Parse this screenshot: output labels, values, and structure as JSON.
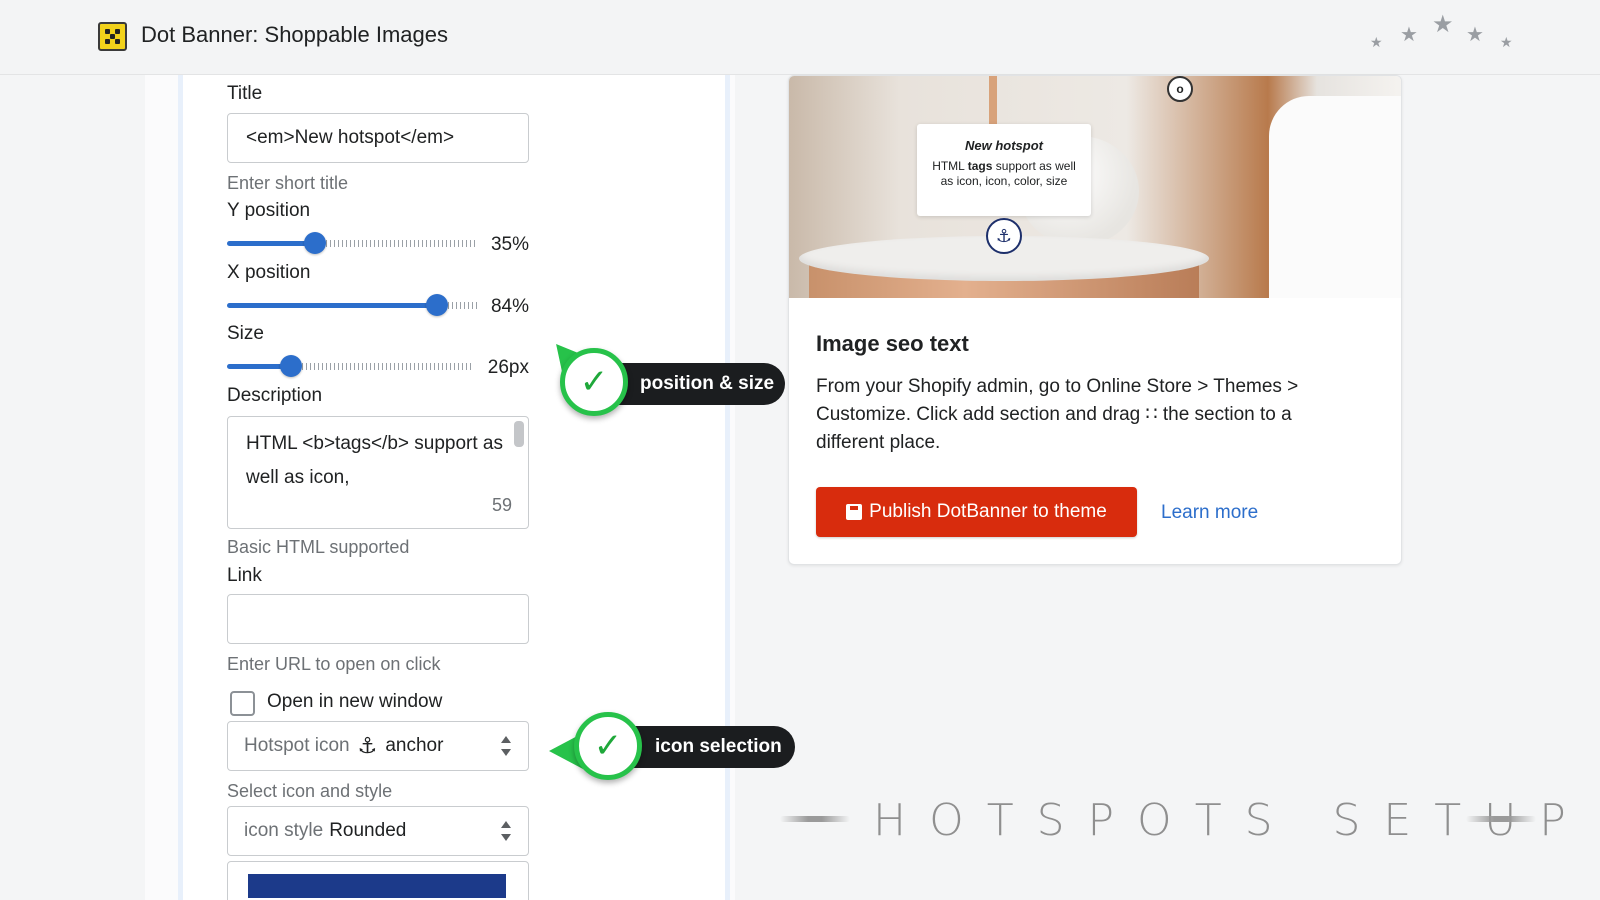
{
  "app": {
    "title": "Dot Banner: Shoppable Images",
    "stars_icon": "stars-icon"
  },
  "form": {
    "title_label": "Title",
    "title_value": "<em>New hotspot</em>",
    "title_help": "Enter short title",
    "y_label": "Y position",
    "y_value": 35,
    "y_display": "35%",
    "x_label": "X position",
    "x_value": 84,
    "x_display": "84%",
    "size_label": "Size",
    "size_value": 26,
    "size_display": "26px",
    "description_label": "Description",
    "description_value": "HTML <b>tags</b> support as well as icon,",
    "description_count": "59",
    "description_help": "Basic HTML supported",
    "link_label": "Link",
    "link_value": "",
    "link_help": "Enter URL to open on click",
    "open_new_window_label": "Open in new window",
    "open_new_window_checked": false,
    "icon_select_key": "Hotspot icon",
    "icon_select_value": "anchor",
    "icon_select_icon": "anchor-icon",
    "icon_help": "Select icon and style",
    "style_select_key": "icon style",
    "style_select_value": "Rounded",
    "color_value": "#1c3a8a"
  },
  "callouts": {
    "position_size": "position & size",
    "icon_selection": "icon selection",
    "accent": "#27c24a"
  },
  "preview": {
    "tooltip_title": "New hotspot",
    "tooltip_body_1": "HTML ",
    "tooltip_body_bold": "tags",
    "tooltip_body_2": " support as well as icon, icon, color, size",
    "heading": "Image seo text",
    "body": "From your Shopify admin, go to Online Store > Themes > Customize. Click add section and drag ∷ the section to a different place.",
    "publish_label": "Publish DotBanner to theme",
    "publish_color": "#d82c0d",
    "learn_more_label": "Learn more",
    "link_color": "#2c6ecb"
  },
  "footer": {
    "setup_title": "HOTSPOTS SETUP"
  }
}
